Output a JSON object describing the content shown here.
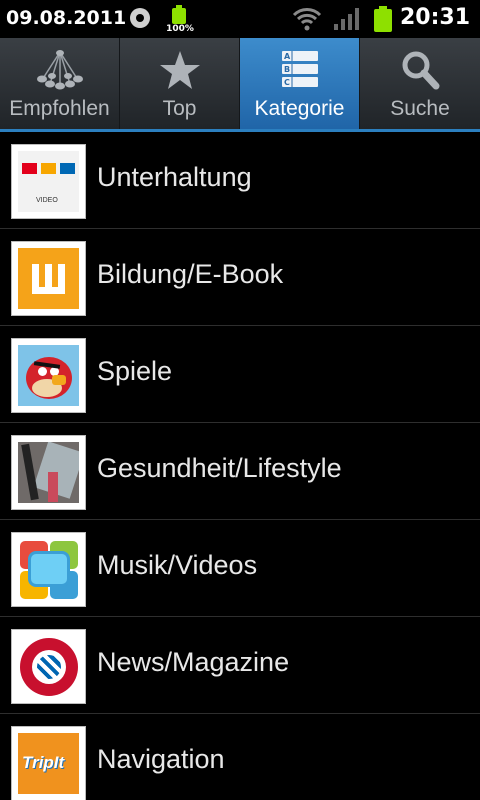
{
  "status_bar": {
    "date": "09.08.2011",
    "battery_small_percent": "100%",
    "time": "20:31"
  },
  "tabs": [
    {
      "label": "Empfohlen",
      "icon": "network-icon",
      "active": false
    },
    {
      "label": "Top",
      "icon": "star-icon",
      "active": true
    },
    {
      "label": "Kategorie",
      "icon": "abc-list-icon",
      "active": true
    },
    {
      "label": "Suche",
      "icon": "search-icon",
      "active": false
    }
  ],
  "categories": [
    {
      "label": "Unterhaltung",
      "icon": "rtl-video-icon"
    },
    {
      "label": "Bildung/E-Book",
      "icon": "ebook-icon"
    },
    {
      "label": "Spiele",
      "icon": "angry-bird-icon"
    },
    {
      "label": "Gesundheit/Lifestyle",
      "icon": "cosmetics-icon"
    },
    {
      "label": "Musik/Videos",
      "icon": "media-icon"
    },
    {
      "label": "News/Magazine",
      "icon": "fc-bayern-icon"
    },
    {
      "label": "Navigation",
      "icon": "tripit-icon"
    }
  ],
  "colors": {
    "accent": "#2b7fbf",
    "background": "#000000",
    "battery": "#8ee000"
  }
}
